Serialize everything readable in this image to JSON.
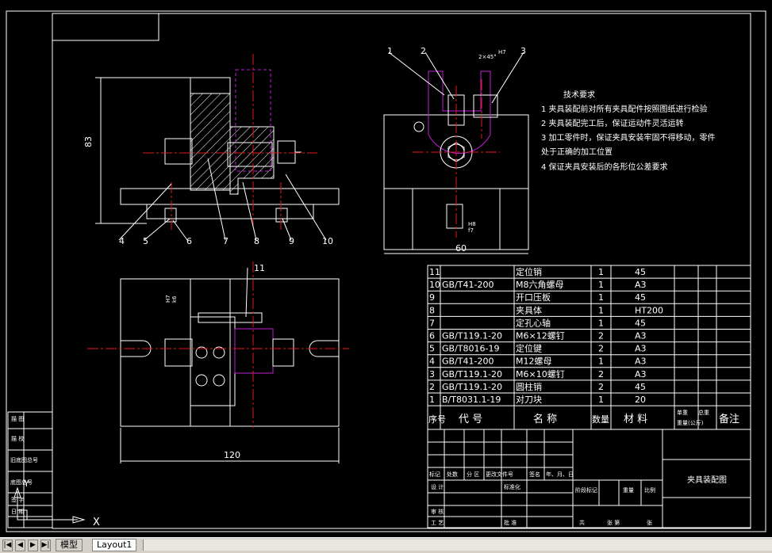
{
  "drawing": {
    "dimensions": {
      "height_left": "83",
      "width_right": "60",
      "width_bottom": "120",
      "chamfer": "2×45°",
      "fit_top": "H7",
      "fit_bottom_a": "H8",
      "fit_bottom_b": "f7",
      "fit_left_a": "H7",
      "fit_left_b": "k6"
    },
    "balloons_top": [
      "4",
      "5",
      "6",
      "7",
      "8",
      "9",
      "10"
    ],
    "balloons_right": [
      "1",
      "2",
      "3"
    ],
    "balloon_bottom": "11",
    "tech_requirements": {
      "title": "技术要求",
      "items": [
        "1  夹具装配前对所有夹具配件按照图纸进行检验",
        "2  夹具装配完工后，保证运动件灵活运转",
        "3  加工零件时，保证夹具安装牢固不得移动，零件",
        "    处于正确的加工位置",
        "4  保证夹具安装后的各形位公差要求"
      ]
    },
    "bom": {
      "rows": [
        {
          "no": "11",
          "code": "",
          "name": "定位销",
          "qty": "1",
          "material": "45"
        },
        {
          "no": "10",
          "code": "GB/T41-200",
          "name": "M8六角螺母",
          "qty": "1",
          "material": "A3"
        },
        {
          "no": "9",
          "code": "",
          "name": "开口压板",
          "qty": "1",
          "material": "45"
        },
        {
          "no": "8",
          "code": "",
          "name": "夹具体",
          "qty": "1",
          "material": "HT200"
        },
        {
          "no": "7",
          "code": "",
          "name": "定孔心轴",
          "qty": "1",
          "material": "45"
        },
        {
          "no": "6",
          "code": "GB/T119.1-20",
          "name": "M6×12螺钉",
          "qty": "2",
          "material": "A3"
        },
        {
          "no": "5",
          "code": "GB/T8016-19",
          "name": "定位键",
          "qty": "2",
          "material": "A3"
        },
        {
          "no": "4",
          "code": "GB/T41-200",
          "name": "M12螺母",
          "qty": "1",
          "material": "A3"
        },
        {
          "no": "3",
          "code": "GB/T119.1-20",
          "name": "M6×10螺钉",
          "qty": "2",
          "material": "A3"
        },
        {
          "no": "2",
          "code": "GB/T119.1-20",
          "name": "圆柱销",
          "qty": "2",
          "material": "45"
        },
        {
          "no": "1",
          "code": "B/T8031.1-19",
          "name": "对刀块",
          "qty": "1",
          "material": "20"
        }
      ],
      "header": {
        "no": "序号",
        "code": "代 号",
        "name": "名 称",
        "qty": "数量",
        "material": "材 料",
        "unit_weight": "单重",
        "total_weight": "总重",
        "weight": "重量(公斤)",
        "remark": "备注"
      }
    },
    "title_block": {
      "drawing_name": "夹具装配图",
      "labels": [
        "标记",
        "处数",
        "分 区",
        "更改文件号",
        "签名",
        "年、月、日",
        "设 计",
        "标准化",
        "审 核",
        "工 艺",
        "批 准",
        "阶段标记",
        "重量",
        "比例",
        "共",
        "张 第",
        "张"
      ]
    },
    "left_column": [
      "描 图",
      "描 校",
      "旧底图总号",
      "底图总号",
      "签 字",
      "日 期"
    ],
    "ucs": {
      "x": "X",
      "y": "Y"
    }
  },
  "tabs": [
    {
      "label": "模型",
      "active": false
    },
    {
      "label": "Layout1",
      "active": true
    }
  ],
  "nav_buttons": [
    "|◀",
    "◀",
    "▶",
    "▶|"
  ]
}
